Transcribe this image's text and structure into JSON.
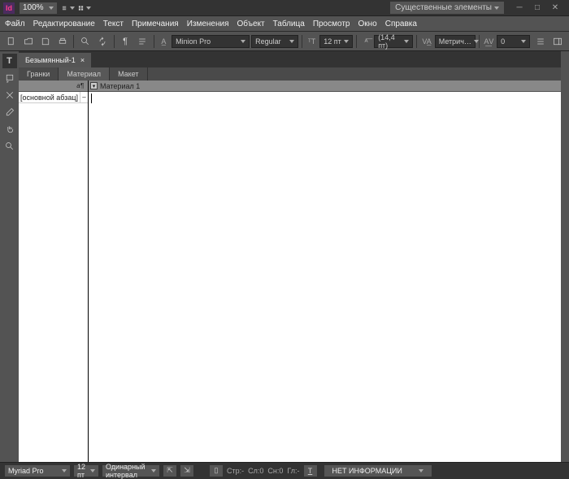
{
  "titlebar": {
    "app_badge": "Id",
    "zoom": "100%",
    "workspace_label": "Существенные элементы"
  },
  "menu": [
    "Файл",
    "Редактирование",
    "Текст",
    "Примечания",
    "Изменения",
    "Объект",
    "Таблица",
    "Просмотр",
    "Окно",
    "Справка"
  ],
  "toolbar": {
    "font": "Minion Pro",
    "font_style": "Regular",
    "size": "12 пт",
    "leading": "(14,4 пт)",
    "kerning": "Метрич…",
    "tracking": "0"
  },
  "doc_tab": {
    "title": "Безымянный-1",
    "close": "×"
  },
  "secondary_tabs": [
    "Гранки",
    "Материал",
    "Макет"
  ],
  "left_panel": {
    "head_ico": "a¶",
    "row0": "[основной абзац]"
  },
  "material": {
    "head": "Материал 1"
  },
  "footer": {
    "font": "Myriad Pro",
    "size": "12 пт",
    "spacing": "Одинарный интервал",
    "stat_str": "Стр:-",
    "stat_col": "Сл:0",
    "stat_chr": "Сн:0",
    "stat_gl": "Гл:-",
    "info": "НЕТ ИНФОРМАЦИИ"
  }
}
